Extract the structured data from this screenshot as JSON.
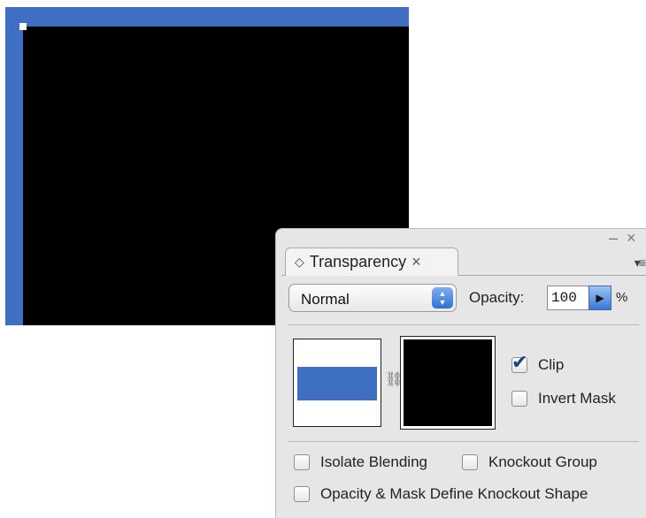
{
  "panel": {
    "tab_title": "Transparency",
    "tab_arrow_icon": "collapse-arrows-icon",
    "tab_close_glyph": "×",
    "minimize_glyph": "–",
    "close_glyph": "×",
    "menu_glyph": "▾≡",
    "blend_mode": {
      "value": "Normal"
    },
    "opacity": {
      "label": "Opacity:",
      "value": "100",
      "unit": "%"
    },
    "clip": {
      "label": "Clip",
      "checked": true
    },
    "invert_mask": {
      "label": "Invert Mask",
      "checked": false
    },
    "isolate_blending": {
      "label": "Isolate Blending",
      "checked": false
    },
    "knockout_group": {
      "label": "Knockout Group",
      "checked": false
    },
    "opacity_mask_knockout": {
      "label": "Opacity & Mask Define Knockout Shape",
      "checked": false
    }
  },
  "colors": {
    "artwork_blue": "#3f6fc3",
    "mask_black": "#000000",
    "accent_blue": "#3a78d8"
  }
}
